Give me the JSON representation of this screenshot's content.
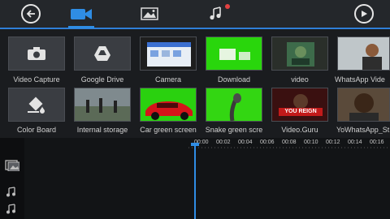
{
  "toolbar": {
    "tabs": [
      "video-tab",
      "photo-tab",
      "music-tab"
    ],
    "active_tab": "video-tab",
    "accent": "#2f8de4"
  },
  "library": {
    "items": [
      {
        "label": "Video Capture"
      },
      {
        "label": "Google Drive"
      },
      {
        "label": "Camera"
      },
      {
        "label": "Download"
      },
      {
        "label": "video"
      },
      {
        "label": "WhatsApp Vide"
      },
      {
        "label": "Color Board"
      },
      {
        "label": "Internal storage"
      },
      {
        "label": "Car green screen"
      },
      {
        "label": "Snake green scre"
      },
      {
        "label": "Video.Guru"
      },
      {
        "label": "YoWhatsApp_St"
      }
    ],
    "thumb_text": {
      "you_reign": "YOU REIGN"
    }
  },
  "timeline": {
    "ticks": [
      "00:00",
      "00:02",
      "00:04",
      "00:06",
      "00:08",
      "00:10",
      "00:12",
      "00:14",
      "00:16"
    ]
  }
}
